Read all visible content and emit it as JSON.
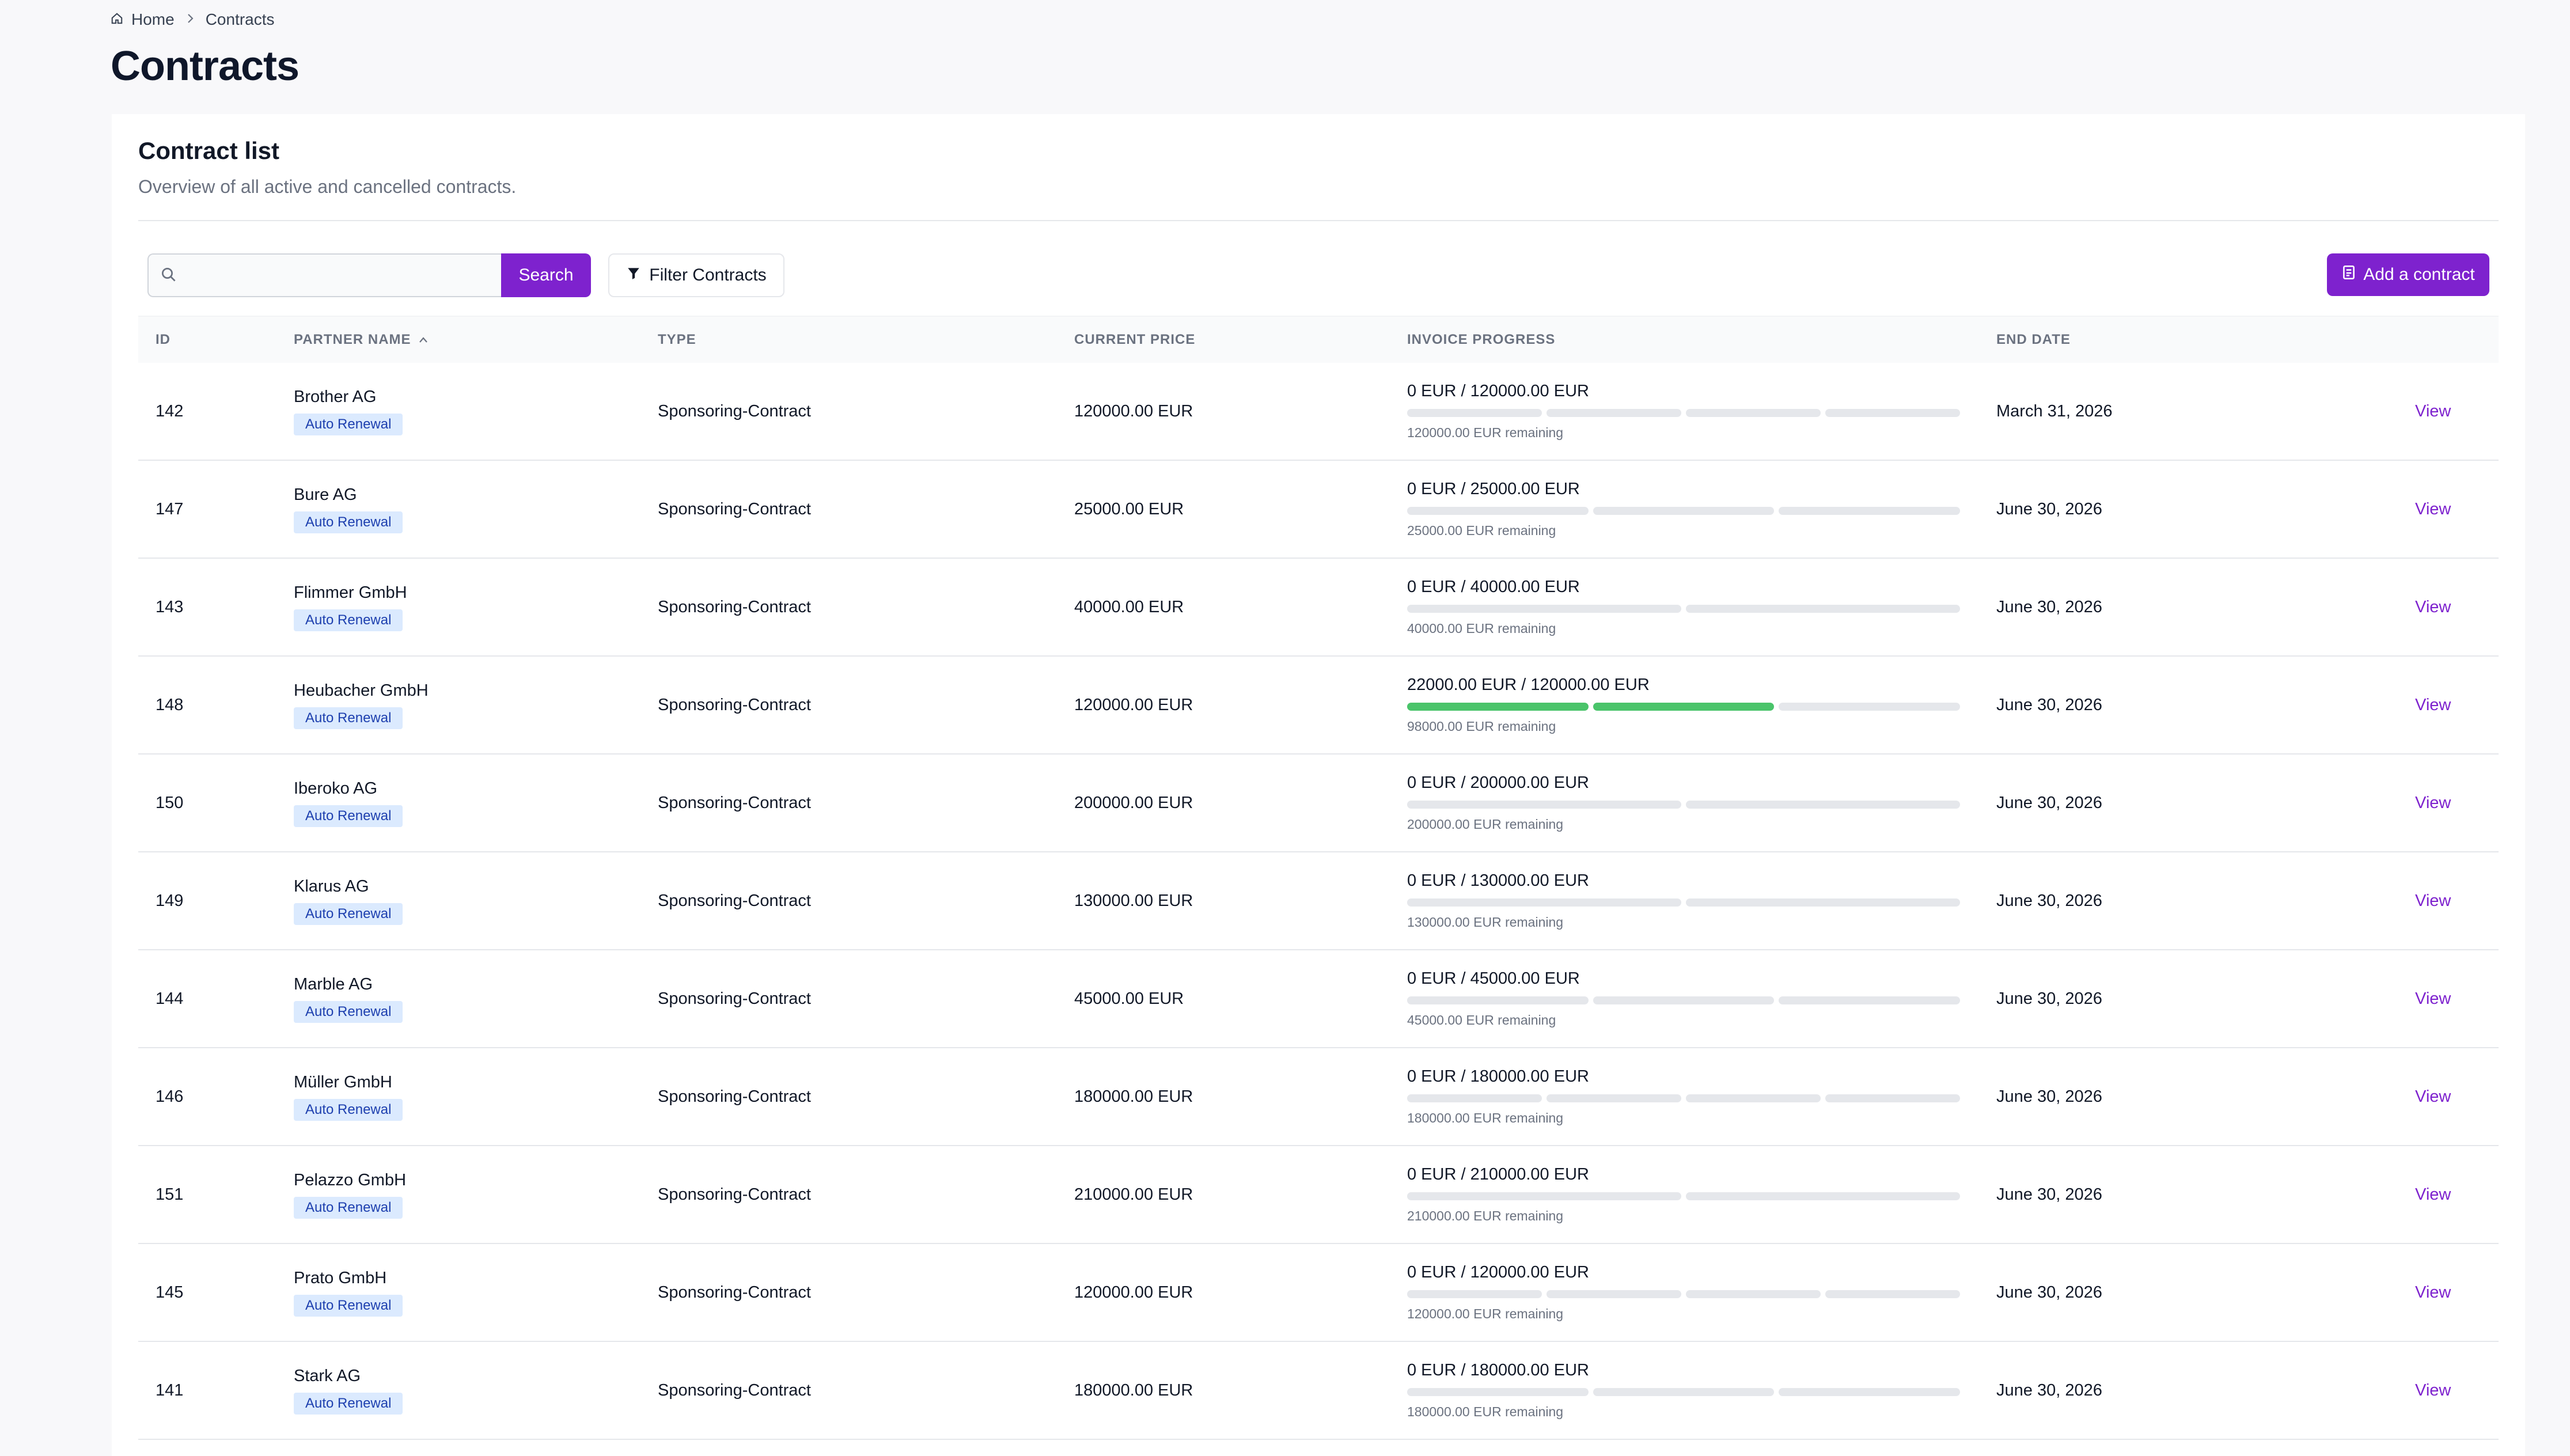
{
  "breadcrumb": {
    "home": "Home",
    "current": "Contracts"
  },
  "page": {
    "title": "Contracts"
  },
  "card": {
    "title": "Contract list",
    "subtitle": "Overview of all active and cancelled contracts."
  },
  "toolbar": {
    "search_placeholder": "",
    "search_label": "Search",
    "filter_label": "Filter Contracts",
    "add_label": "Add a contract"
  },
  "table": {
    "columns": [
      "ID",
      "PARTNER NAME",
      "TYPE",
      "CURRENT PRICE",
      "INVOICE PROGRESS",
      "END DATE"
    ],
    "sorted_column": "PARTNER NAME",
    "sort_direction": "ascending",
    "rows": [
      {
        "id": "142",
        "partner": "Brother AG",
        "badge": "Auto Renewal",
        "type": "Sponsoring-Contract",
        "price": "120000.00 EUR",
        "progress_text": "0 EUR / 120000.00 EUR",
        "segments": 4,
        "filled": 0,
        "remaining": "120000.00 EUR remaining",
        "end_date": "March 31, 2026",
        "action": "View"
      },
      {
        "id": "147",
        "partner": "Bure AG",
        "badge": "Auto Renewal",
        "type": "Sponsoring-Contract",
        "price": "25000.00 EUR",
        "progress_text": "0 EUR / 25000.00 EUR",
        "segments": 3,
        "filled": 0,
        "remaining": "25000.00 EUR remaining",
        "end_date": "June 30, 2026",
        "action": "View"
      },
      {
        "id": "143",
        "partner": "Flimmer GmbH",
        "badge": "Auto Renewal",
        "type": "Sponsoring-Contract",
        "price": "40000.00 EUR",
        "progress_text": "0 EUR / 40000.00 EUR",
        "segments": 2,
        "filled": 0,
        "remaining": "40000.00 EUR remaining",
        "end_date": "June 30, 2026",
        "action": "View"
      },
      {
        "id": "148",
        "partner": "Heubacher GmbH",
        "badge": "Auto Renewal",
        "type": "Sponsoring-Contract",
        "price": "120000.00 EUR",
        "progress_text": "22000.00 EUR / 120000.00 EUR",
        "segments": 3,
        "filled": 2,
        "remaining": "98000.00 EUR remaining",
        "end_date": "June 30, 2026",
        "action": "View"
      },
      {
        "id": "150",
        "partner": "Iberoko AG",
        "badge": "Auto Renewal",
        "type": "Sponsoring-Contract",
        "price": "200000.00 EUR",
        "progress_text": "0 EUR / 200000.00 EUR",
        "segments": 2,
        "filled": 0,
        "remaining": "200000.00 EUR remaining",
        "end_date": "June 30, 2026",
        "action": "View"
      },
      {
        "id": "149",
        "partner": "Klarus AG",
        "badge": "Auto Renewal",
        "type": "Sponsoring-Contract",
        "price": "130000.00 EUR",
        "progress_text": "0 EUR / 130000.00 EUR",
        "segments": 2,
        "filled": 0,
        "remaining": "130000.00 EUR remaining",
        "end_date": "June 30, 2026",
        "action": "View"
      },
      {
        "id": "144",
        "partner": "Marble AG",
        "badge": "Auto Renewal",
        "type": "Sponsoring-Contract",
        "price": "45000.00 EUR",
        "progress_text": "0 EUR / 45000.00 EUR",
        "segments": 3,
        "filled": 0,
        "remaining": "45000.00 EUR remaining",
        "end_date": "June 30, 2026",
        "action": "View"
      },
      {
        "id": "146",
        "partner": "Müller GmbH",
        "badge": "Auto Renewal",
        "type": "Sponsoring-Contract",
        "price": "180000.00 EUR",
        "progress_text": "0 EUR / 180000.00 EUR",
        "segments": 4,
        "filled": 0,
        "remaining": "180000.00 EUR remaining",
        "end_date": "June 30, 2026",
        "action": "View"
      },
      {
        "id": "151",
        "partner": "Pelazzo GmbH",
        "badge": "Auto Renewal",
        "type": "Sponsoring-Contract",
        "price": "210000.00 EUR",
        "progress_text": "0 EUR / 210000.00 EUR",
        "segments": 2,
        "filled": 0,
        "remaining": "210000.00 EUR remaining",
        "end_date": "June 30, 2026",
        "action": "View"
      },
      {
        "id": "145",
        "partner": "Prato GmbH",
        "badge": "Auto Renewal",
        "type": "Sponsoring-Contract",
        "price": "120000.00 EUR",
        "progress_text": "0 EUR / 120000.00 EUR",
        "segments": 4,
        "filled": 0,
        "remaining": "120000.00 EUR remaining",
        "end_date": "June 30, 2026",
        "action": "View"
      },
      {
        "id": "141",
        "partner": "Stark AG",
        "badge": "Auto Renewal",
        "type": "Sponsoring-Contract",
        "price": "180000.00 EUR",
        "progress_text": "0 EUR / 180000.00 EUR",
        "segments": 3,
        "filled": 0,
        "remaining": "180000.00 EUR remaining",
        "end_date": "June 30, 2026",
        "action": "View"
      }
    ]
  },
  "colors": {
    "accent": "#7e22ce",
    "progress_filled": "#4ac46a",
    "progress_empty": "#e5e7eb",
    "badge_bg": "#dbeafe",
    "badge_text": "#1e40af"
  },
  "icons": {
    "home": "home-icon",
    "breadcrumb_separator": "chevron-right-icon",
    "search": "search-icon",
    "filter": "filter-icon",
    "add": "add-contract-icon",
    "sort": "chevron-up-icon"
  }
}
